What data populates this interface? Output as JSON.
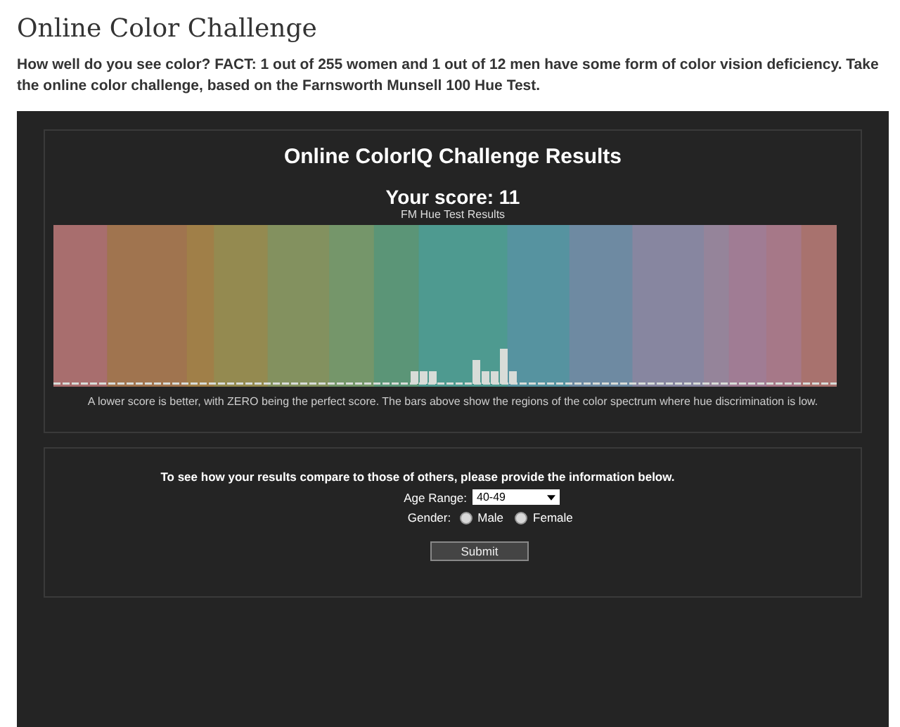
{
  "page_title": "Online Color Challenge",
  "intro": "How well do you see color? FACT: 1 out of 255 women and 1 out of 12 men have some form of color vision deficiency. Take the online color challenge, based on the Farnsworth Munsell 100 Hue Test.",
  "results": {
    "title": "Online ColorIQ Challenge Results",
    "score": "Your score: 11",
    "chart_caption": "FM Hue Test Results",
    "note": "A lower score is better, with ZERO being the perfect score. The bars above show the regions of the color spectrum where hue discrimination is low."
  },
  "form": {
    "prompt": "To see how your results compare to those of others, please provide the information below.",
    "age_label": "Age Range:",
    "age_value": "40-49",
    "gender_label": "Gender:",
    "genders": [
      {
        "label": "Male",
        "selected": false
      },
      {
        "label": "Female",
        "selected": false
      }
    ],
    "submit": "Submit"
  }
}
